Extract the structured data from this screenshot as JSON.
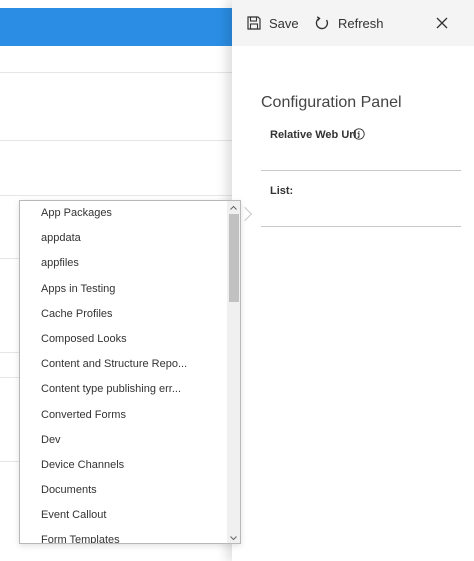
{
  "toolbar": {
    "save_label": "Save",
    "refresh_label": "Refresh"
  },
  "panel": {
    "title": "Configuration Panel",
    "fields": {
      "relative_web_url_label": "Relative Web Url:",
      "list_label": "List:"
    }
  },
  "dropdown": {
    "items": [
      "App Packages",
      "appdata",
      "appfiles",
      "Apps in Testing",
      "Cache Profiles",
      "Composed Looks",
      "Content and Structure Repo...",
      "Content type publishing err...",
      "Converted Forms",
      "Dev",
      "Device Channels",
      "Documents",
      "Event Callout",
      "Form Templates"
    ]
  },
  "colors": {
    "topbar": "#2b8ee4",
    "cmdbar": "#f4f4f4"
  },
  "icons": {
    "save": "save-icon",
    "refresh": "refresh-icon",
    "close": "close-icon",
    "info": "info-icon"
  }
}
